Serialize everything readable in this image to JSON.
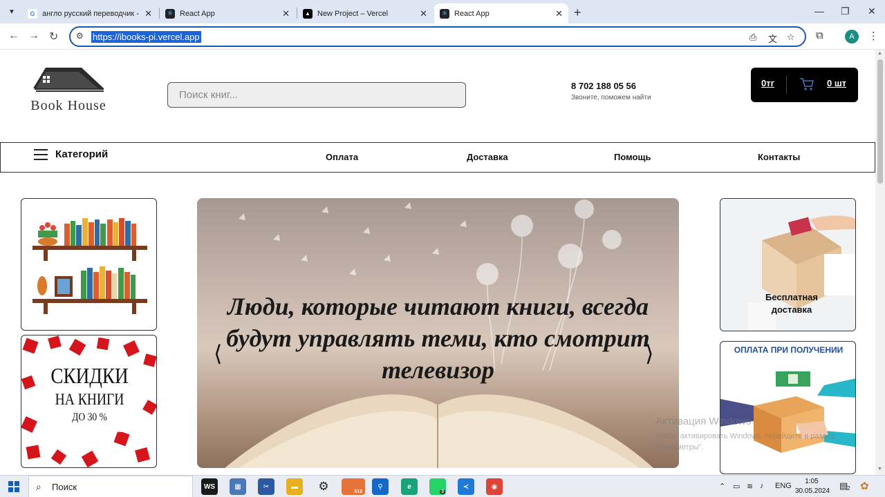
{
  "browser": {
    "tabs": [
      {
        "title": "англо русский переводчик - П",
        "favicon": "google-favicon",
        "active": false
      },
      {
        "title": "React App",
        "favicon": "react-favicon",
        "active": false
      },
      {
        "title": "New Project – Vercel",
        "favicon": "vercel-favicon",
        "active": false
      },
      {
        "title": "React App",
        "favicon": "react-favicon",
        "active": true
      }
    ],
    "new_tab": "+",
    "url": "https://ibooks-pi.vercel.app",
    "profile_initial": "A"
  },
  "header": {
    "logo_text": "Book House",
    "search_placeholder": "Поиск книг...",
    "phone": "8 702 188 05 56",
    "phone_sub": "Звоните, поможем найти",
    "cart_sum": "0тг",
    "cart_count": "0 шт"
  },
  "nav": {
    "categories_label": "Категорий",
    "links": [
      "Оплата",
      "Доставка",
      "Помощь",
      "Контакты"
    ]
  },
  "promo": {
    "discount_line1": "СКИДКИ",
    "discount_line2": "НА КНИГИ",
    "discount_line3": "ДО 30 %",
    "free_delivery": "Бесплатная доставка",
    "cod_title": "ОПЛАТА ПРИ ПОЛУЧЕНИИ"
  },
  "hero": {
    "quote": "Люди, которые читают книги, всегда будут управлять теми, кто смотрит телевизор",
    "prev": "⟨",
    "next": "⟩"
  },
  "watermark": {
    "title": "Активация Windows",
    "text": "Чтобы активировать Windows, перейдите в раздел \"Параметры\"."
  },
  "taskbar": {
    "search_label": "Поиск",
    "telegram_badge": "512",
    "whatsapp_badge": "3",
    "language": "ENG",
    "time": "1:05",
    "date": "30.05.2024",
    "notifications": "2"
  }
}
